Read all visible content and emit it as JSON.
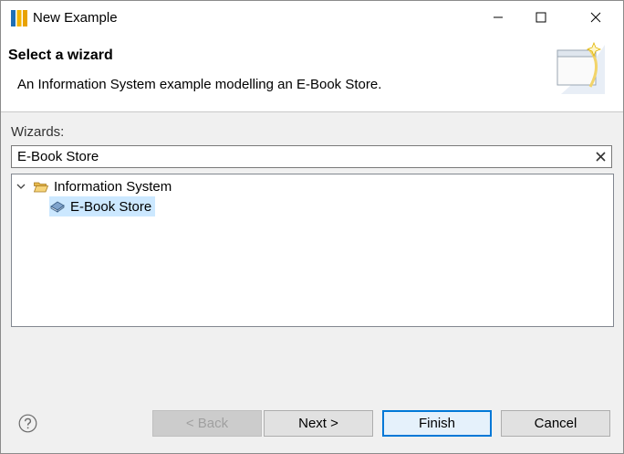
{
  "window": {
    "title": "New Example",
    "icon": "eclipse-app-icon"
  },
  "banner": {
    "title": "Select a wizard",
    "description": "An Information System example modelling an E-Book Store.",
    "graphic": "wizard-banner-icon"
  },
  "wizards": {
    "label": "Wizards:",
    "filter_value": "E-Book Store"
  },
  "tree": {
    "items": [
      {
        "label": "Information System",
        "icon": "folder-open-icon",
        "expanded": true,
        "children": [
          {
            "label": "E-Book Store",
            "icon": "book-icon",
            "selected": true
          }
        ]
      }
    ]
  },
  "buttons": {
    "back": "< Back",
    "next": "Next >",
    "finish": "Finish",
    "cancel": "Cancel"
  },
  "colors": {
    "selection": "#cce8ff",
    "default_button_border": "#0078d7"
  }
}
